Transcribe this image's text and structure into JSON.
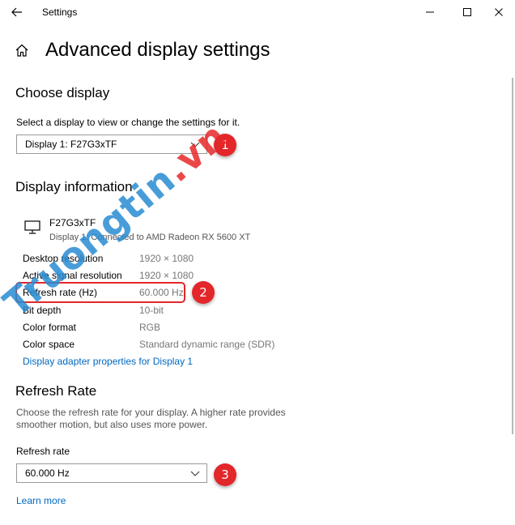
{
  "window": {
    "title": "Settings"
  },
  "page": {
    "title": "Advanced display settings"
  },
  "choose_display": {
    "heading": "Choose display",
    "description": "Select a display to view or change the settings for it.",
    "selected": "Display 1: F27G3xTF"
  },
  "display_info": {
    "heading": "Display information",
    "monitor_name": "F27G3xTF",
    "monitor_sub": "Display 1: Connected to AMD Radeon RX 5600 XT",
    "rows": [
      {
        "label": "Desktop resolution",
        "value": "1920 × 1080"
      },
      {
        "label": "Active signal resolution",
        "value": "1920 × 1080"
      },
      {
        "label": "Refresh rate (Hz)",
        "value": "60.000 Hz"
      },
      {
        "label": "Bit depth",
        "value": "10-bit"
      },
      {
        "label": "Color format",
        "value": "RGB"
      },
      {
        "label": "Color space",
        "value": "Standard dynamic range (SDR)"
      }
    ],
    "adapter_link": "Display adapter properties for Display 1"
  },
  "refresh_rate": {
    "heading": "Refresh Rate",
    "description_line1": "Choose the refresh rate for your display. A higher rate provides",
    "description_line2": "smoother motion, but also uses more power.",
    "field_label": "Refresh rate",
    "selected": "60.000 Hz",
    "learn_more": "Learn more"
  },
  "badges": [
    "1",
    "2",
    "3"
  ],
  "watermark": {
    "text_main": "Truongtin",
    "text_accent": ".vn"
  },
  "colors": {
    "accent_link": "#0067c0",
    "badge_red": "#e3262a"
  },
  "icons": [
    "back-arrow-icon",
    "minimize-icon",
    "maximize-icon",
    "close-icon",
    "home-icon",
    "monitor-icon",
    "chevron-down-icon"
  ]
}
